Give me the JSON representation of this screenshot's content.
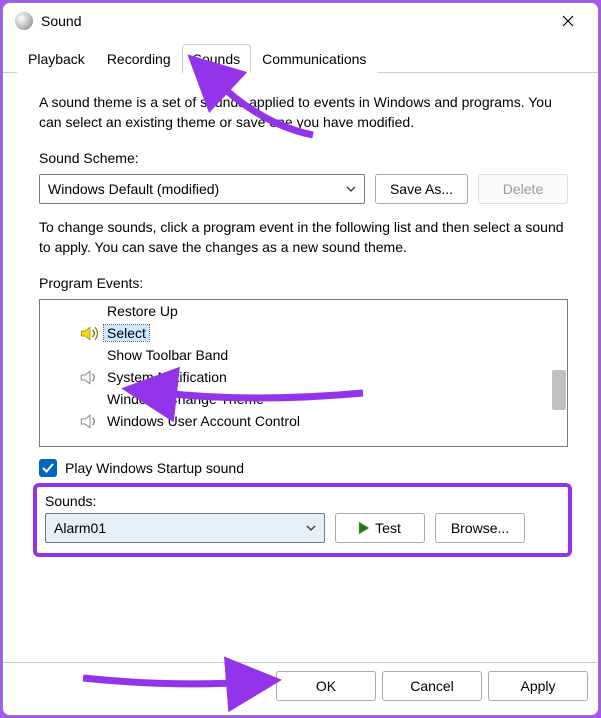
{
  "window": {
    "title": "Sound"
  },
  "tabs": [
    {
      "label": "Playback",
      "active": false
    },
    {
      "label": "Recording",
      "active": false
    },
    {
      "label": "Sounds",
      "active": true
    },
    {
      "label": "Communications",
      "active": false
    }
  ],
  "description": "A sound theme is a set of sounds applied to events in Windows and programs. You can select an existing theme or save one you have modified.",
  "scheme": {
    "label": "Sound Scheme:",
    "value": "Windows Default (modified)",
    "saveas": "Save As...",
    "delete": "Delete"
  },
  "change_desc": "To change sounds, click a program event in the following list and then select a sound to apply. You can save the changes as a new sound theme.",
  "events": {
    "label": "Program Events:",
    "items": [
      {
        "name": "Restore Up",
        "icon": "none",
        "selected": false
      },
      {
        "name": "Select",
        "icon": "yellow",
        "selected": true
      },
      {
        "name": "Show Toolbar Band",
        "icon": "none",
        "selected": false
      },
      {
        "name": "System Notification",
        "icon": "gray",
        "selected": false
      },
      {
        "name": "Windows Change Theme",
        "icon": "none",
        "selected": false
      },
      {
        "name": "Windows User Account Control",
        "icon": "gray",
        "selected": false
      }
    ]
  },
  "startup": {
    "label": "Play Windows Startup sound",
    "checked": true
  },
  "sounds": {
    "label": "Sounds:",
    "value": "Alarm01",
    "test": "Test",
    "browse": "Browse..."
  },
  "footer": {
    "ok": "OK",
    "cancel": "Cancel",
    "apply": "Apply"
  }
}
